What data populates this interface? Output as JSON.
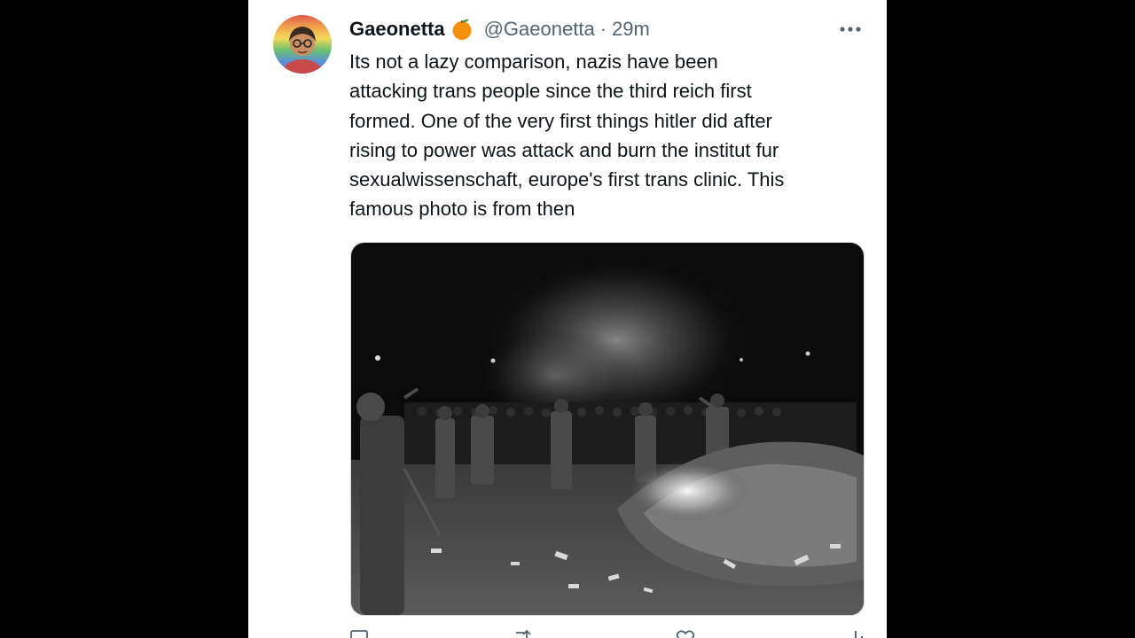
{
  "tweet": {
    "display_name": "Gaeonetta",
    "handle": "@Gaeonetta",
    "separator": "·",
    "time": "29m",
    "text": "Its not a lazy comparison, nazis have been\nattacking trans people since the third reich first\nformed. One of the very first things hitler did after\nrising to power was attack and burn the institut fur\nsexualwissenschaft, europe's first trans clinic. This\nfamous photo is from then",
    "badge_icon": "orange-emoji-icon",
    "more_icon": "more-icon"
  },
  "colors": {
    "background": "#000000",
    "card": "#ffffff",
    "text_primary": "#0f1419",
    "text_secondary": "#536471",
    "badge": "#f4900c"
  },
  "actions": [
    {
      "icon": "reply-icon"
    },
    {
      "icon": "retweet-icon"
    },
    {
      "icon": "like-icon"
    },
    {
      "icon": "views-icon"
    }
  ]
}
